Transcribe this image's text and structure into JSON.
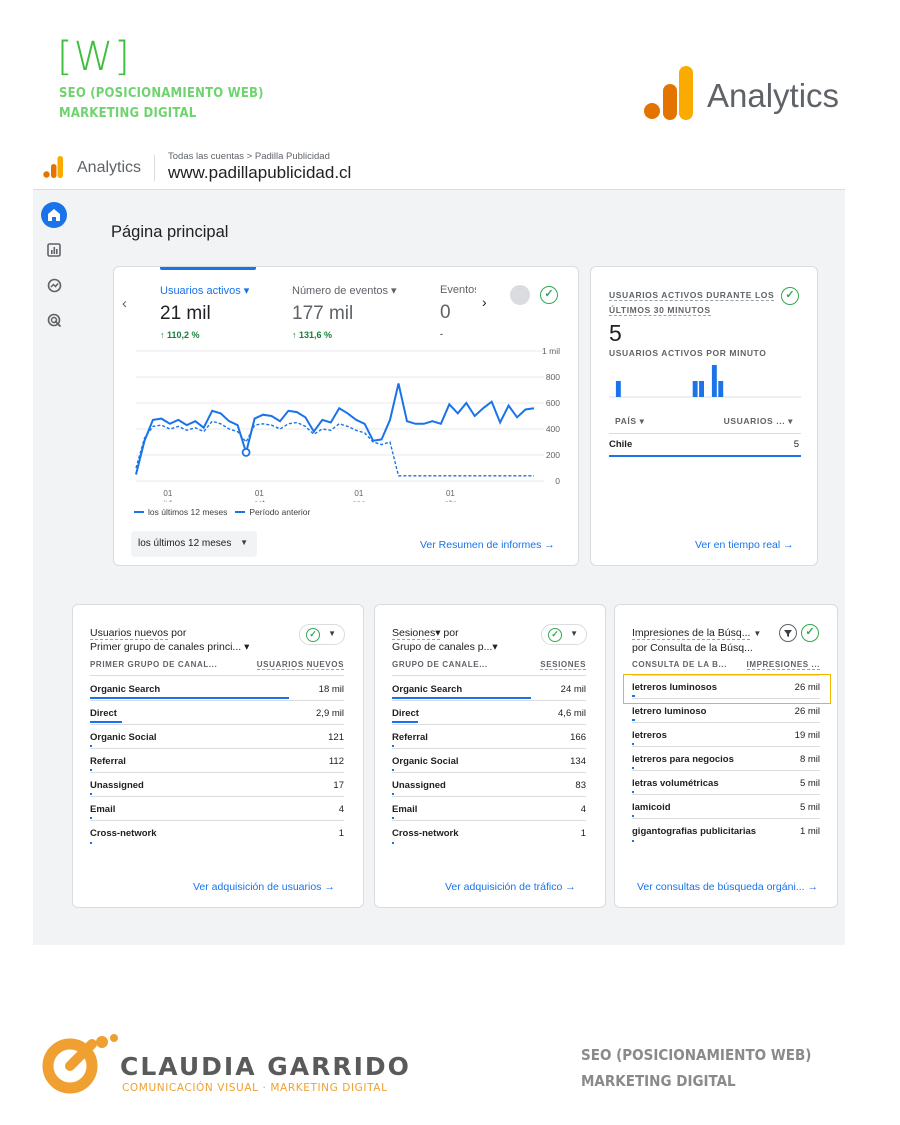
{
  "brand": {
    "logo_text": "[W]",
    "line1": "SEO (POSICIONAMIENTO WEB)",
    "line2": "MARKETING DIGITAL",
    "analytics_label": "Analytics",
    "colors": {
      "green": "#3fbf3f",
      "orange": "#f9ab00",
      "orange_dark": "#e37400"
    }
  },
  "ga_header": {
    "product": "Analytics",
    "breadcrumb": "Todas las cuentas > Padilla Publicidad",
    "property": "www.padillapublicidad.cl"
  },
  "nav_rail": [
    "home-icon",
    "reports-icon",
    "explore-icon",
    "advertising-icon"
  ],
  "page_title": "Página principal",
  "main_card": {
    "metrics": [
      {
        "label": "Usuarios activos ▾",
        "value": "21 mil",
        "change": "↑ 110,2 %"
      },
      {
        "label": "Número de eventos ▾",
        "value": "177 mil",
        "change": "↑ 131,6 %"
      },
      {
        "label": "Eventos",
        "value": "0",
        "change": "-"
      }
    ],
    "legend_current": "los últimos 12 meses",
    "legend_previous": "Período anterior",
    "range_button": "los últimos 12 meses",
    "link": "Ver Resumen de informes →"
  },
  "chart_data": {
    "type": "line",
    "title": "",
    "xlabel": "",
    "ylabel": "",
    "ylim": [
      0,
      1000
    ],
    "y_ticks": [
      "1 mil",
      "800",
      "600",
      "400",
      "200",
      "0"
    ],
    "x_ticks": [
      {
        "day": "01",
        "month": "jul"
      },
      {
        "day": "01",
        "month": "oct"
      },
      {
        "day": "01",
        "month": "ene"
      },
      {
        "day": "01",
        "month": "abr"
      }
    ],
    "series": [
      {
        "name": "los últimos 12 meses",
        "style": "solid",
        "color": "#1a73e8",
        "values": [
          50,
          310,
          470,
          480,
          440,
          470,
          430,
          460,
          410,
          540,
          520,
          460,
          430,
          220,
          480,
          510,
          500,
          460,
          540,
          530,
          490,
          380,
          470,
          450,
          560,
          520,
          470,
          440,
          310,
          320,
          470,
          750,
          460,
          440,
          440,
          460,
          440,
          590,
          520,
          600,
          500,
          560,
          610,
          450,
          580,
          490,
          550,
          560
        ]
      },
      {
        "name": "Período anterior",
        "style": "dashed",
        "color": "#1a73e8",
        "values": [
          100,
          330,
          420,
          430,
          400,
          420,
          390,
          410,
          380,
          460,
          440,
          400,
          380,
          300,
          430,
          440,
          430,
          400,
          440,
          450,
          420,
          360,
          400,
          390,
          440,
          420,
          390,
          370,
          300,
          280,
          300,
          40,
          40,
          40,
          40,
          40,
          40,
          40,
          40,
          40,
          40,
          40,
          40,
          40,
          40,
          40,
          40,
          40
        ]
      }
    ],
    "grid": true,
    "marker_label": ""
  },
  "realtime_card": {
    "title_line1": "USUARIOS ACTIVOS DURANTE LOS",
    "title_line2": "ÚLTIMOS 30 MINUTOS",
    "value": "5",
    "subtitle": "USUARIOS ACTIVOS POR MINUTO",
    "per_minute": [
      0,
      1,
      0,
      0,
      0,
      0,
      0,
      0,
      0,
      0,
      0,
      0,
      0,
      1,
      1,
      0,
      2,
      1,
      0,
      0,
      0,
      0,
      0,
      0,
      0,
      0,
      0,
      0,
      0,
      0
    ],
    "col_country": "PAÍS ▾",
    "col_users": "USUARIOS ... ▾",
    "rows": [
      {
        "country": "Chile",
        "users": "5"
      }
    ],
    "link": "Ver en tiempo real →"
  },
  "card_new_users": {
    "title_line1": "Usuarios nuevos",
    "title_por": " por",
    "title_line2": "Primer grupo de canales princi... ▾",
    "col1": "PRIMER GRUPO DE CANAL...",
    "col2": "USUARIOS NUEVOS",
    "rows": [
      {
        "name": "Organic Search",
        "value": "18 mil",
        "share": 1.0
      },
      {
        "name": "Direct",
        "value": "2,9 mil",
        "share": 0.16
      },
      {
        "name": "Organic Social",
        "value": "121",
        "share": 0.01
      },
      {
        "name": "Referral",
        "value": "112",
        "share": 0.01
      },
      {
        "name": "Unassigned",
        "value": "17",
        "share": 0.005
      },
      {
        "name": "Email",
        "value": "4",
        "share": 0.002
      },
      {
        "name": "Cross-network",
        "value": "1",
        "share": 0.001
      }
    ],
    "link": "Ver adquisición de usuarios →"
  },
  "card_sessions": {
    "title_line1": "Sesiones▾",
    "title_por": " por",
    "title_line2": "Grupo de canales p...▾",
    "col1": "GRUPO DE CANALE...",
    "col2": "SESIONES",
    "rows": [
      {
        "name": "Organic Search",
        "value": "24 mil",
        "share": 1.0
      },
      {
        "name": "Direct",
        "value": "4,6 mil",
        "share": 0.19
      },
      {
        "name": "Referral",
        "value": "166",
        "share": 0.01
      },
      {
        "name": "Organic Social",
        "value": "134",
        "share": 0.01
      },
      {
        "name": "Unassigned",
        "value": "83",
        "share": 0.005
      },
      {
        "name": "Email",
        "value": "4",
        "share": 0.002
      },
      {
        "name": "Cross-network",
        "value": "1",
        "share": 0.001
      }
    ],
    "link": "Ver adquisición de tráfico →"
  },
  "card_search": {
    "title_line1": "Impresiones de la Búsq...",
    "title_line2": "por Consulta de la Búsq...",
    "col1": "CONSULTA DE LA B...",
    "col2": "IMPRESIONES ...",
    "rows": [
      {
        "name": "letreros luminosos",
        "value": "26 mil",
        "share": 0.02
      },
      {
        "name": "letrero luminoso",
        "value": "26 mil",
        "share": 0.02
      },
      {
        "name": "letreros",
        "value": "19 mil",
        "share": 0.015
      },
      {
        "name": "letreros para negocios",
        "value": "8 mil",
        "share": 0.01
      },
      {
        "name": "letras volumétricas",
        "value": "5 mil",
        "share": 0.008
      },
      {
        "name": "lamicoid",
        "value": "5 mil",
        "share": 0.008
      },
      {
        "name": "gigantografias publicitarias",
        "value": "1 mil",
        "share": 0.005
      }
    ],
    "link": "Ver consultas de búsqueda orgáni... →"
  },
  "footer": {
    "name": "CLAUDIA GARRIDO",
    "tagline": "COMUNICACIÓN VISUAL · MARKETING DIGITAL",
    "line1": "SEO (POSICIONAMIENTO WEB)",
    "line2": "MARKETING DIGITAL"
  }
}
